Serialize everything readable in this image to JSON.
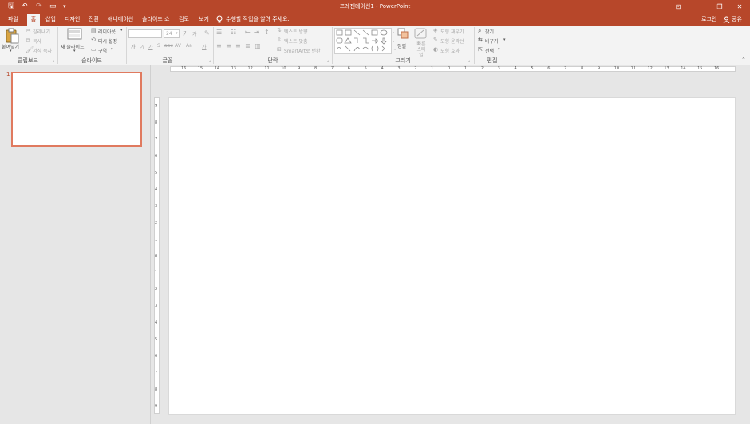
{
  "window": {
    "title": "프레젠테이션1 - PowerPoint",
    "buttons": {
      "restore": "⊡",
      "minimize": "─",
      "maximize": "❐",
      "close": "✕"
    },
    "qat": {
      "save": "🖫",
      "undo": "↶",
      "redo": "↷",
      "present": "▭",
      "more": "▾"
    }
  },
  "tabs": [
    {
      "label": "파일"
    },
    {
      "label": "홈"
    },
    {
      "label": "삽입"
    },
    {
      "label": "디자인"
    },
    {
      "label": "전환"
    },
    {
      "label": "애니메이션"
    },
    {
      "label": "슬라이드 쇼"
    },
    {
      "label": "검토"
    },
    {
      "label": "보기"
    }
  ],
  "tellme": "수행할 작업을 알려 주세요.",
  "account": {
    "login": "로그인",
    "share": "공유"
  },
  "ribbon": {
    "clipboard": {
      "paste": "붙여넣기",
      "cut": "잘라내기",
      "copy": "복사",
      "format_painter": "서식 복사",
      "group": "클립보드"
    },
    "slides": {
      "new_slide": "새 슬라이드",
      "layout": "레이아웃",
      "reset": "다시 설정",
      "section": "구역",
      "group": "슬라이드"
    },
    "font": {
      "size_value": "24",
      "group": "글꼴",
      "grow": "가",
      "shrink": "가",
      "bold": "가",
      "italic": "가",
      "underline": "가",
      "strike": "S",
      "aa": "Aa",
      "spacing": "AV",
      "clear": "✎",
      "color": "가"
    },
    "paragraph": {
      "text_direction": "텍스트 방향",
      "align_text": "텍스트 맞춤",
      "smartart": "SmartArt로 변환",
      "group": "단락"
    },
    "drawing": {
      "arrange": "정렬",
      "quick_styles": "빠른 스타일",
      "shape_fill": "도형 채우기",
      "shape_outline": "도형 윤곽선",
      "shape_effects": "도형 효과",
      "group": "그리기"
    },
    "editing": {
      "find": "찾기",
      "replace": "바꾸기",
      "select": "선택",
      "group": "편집"
    }
  },
  "slides": [
    {
      "number": "1"
    }
  ],
  "ruler": {
    "h": [
      "16",
      "15",
      "14",
      "13",
      "12",
      "11",
      "10",
      "9",
      "8",
      "7",
      "6",
      "5",
      "4",
      "3",
      "2",
      "1",
      "0",
      "1",
      "2",
      "3",
      "4",
      "5",
      "6",
      "7",
      "8",
      "9",
      "10",
      "11",
      "12",
      "13",
      "14",
      "15",
      "16"
    ],
    "v": [
      "9",
      "8",
      "7",
      "6",
      "5",
      "4",
      "3",
      "2",
      "1",
      "0",
      "1",
      "2",
      "3",
      "4",
      "5",
      "6",
      "7",
      "8",
      "9"
    ]
  },
  "colors": {
    "accent": "#b7472a",
    "thumb_border": "#e07a5f"
  }
}
